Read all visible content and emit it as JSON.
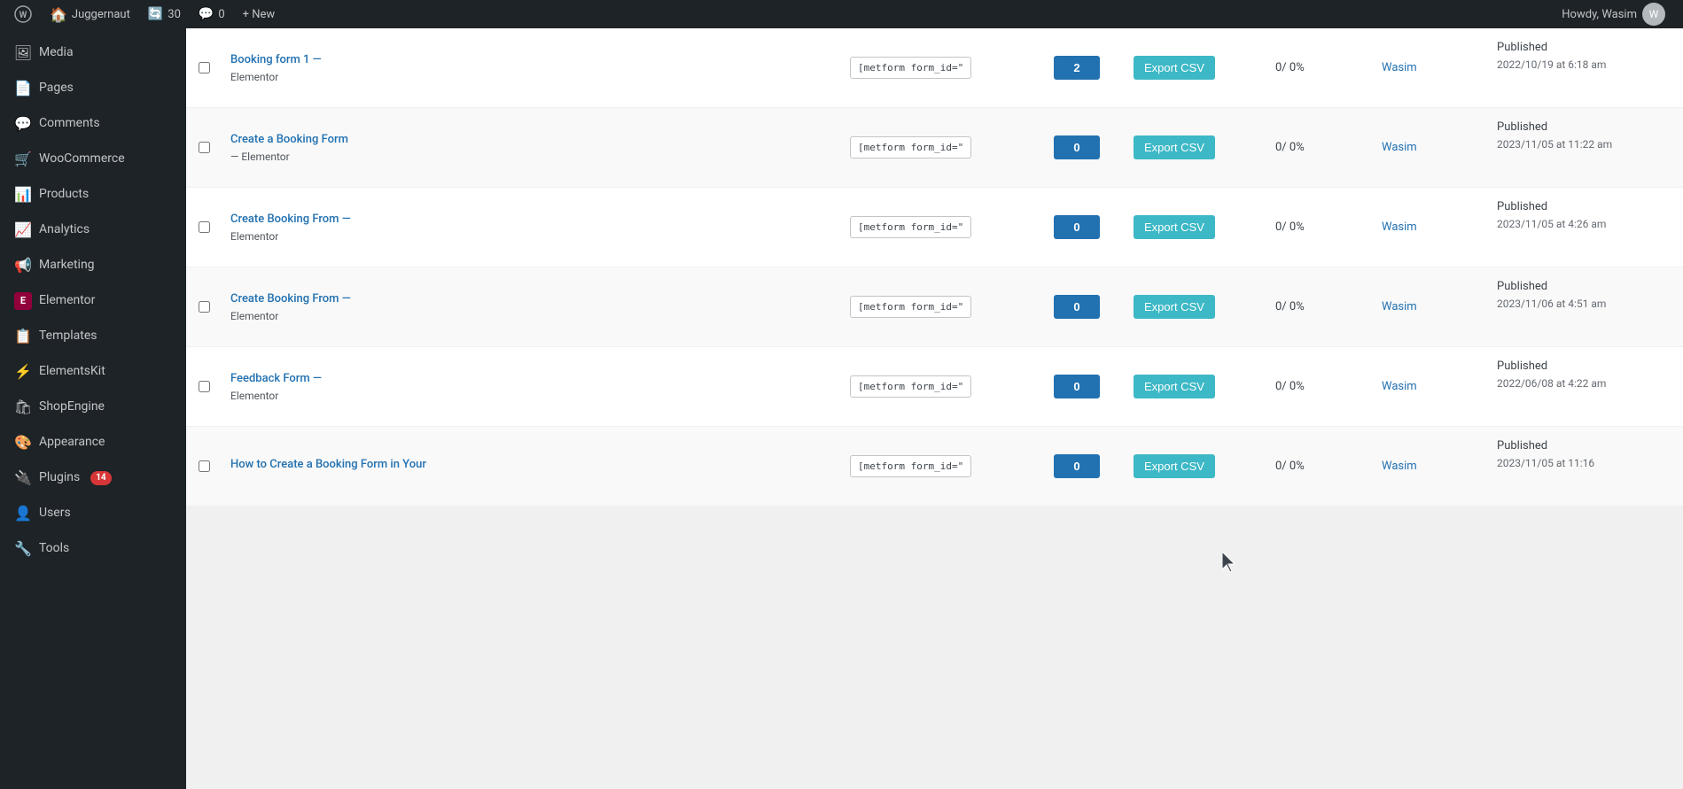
{
  "adminBar": {
    "siteName": "Juggernaut",
    "updates": "30",
    "comments": "0",
    "newLabel": "+ New",
    "howdy": "Howdy, Wasim"
  },
  "sidebar": {
    "items": [
      {
        "id": "media",
        "label": "Media",
        "icon": "🖼"
      },
      {
        "id": "pages",
        "label": "Pages",
        "icon": "📄"
      },
      {
        "id": "comments",
        "label": "Comments",
        "icon": "💬"
      },
      {
        "id": "woocommerce",
        "label": "WooCommerce",
        "icon": "🛒"
      },
      {
        "id": "products",
        "label": "Products",
        "icon": "📊"
      },
      {
        "id": "analytics",
        "label": "Analytics",
        "icon": "📈"
      },
      {
        "id": "marketing",
        "label": "Marketing",
        "icon": "📢"
      },
      {
        "id": "elementor",
        "label": "Elementor",
        "icon": "⬛"
      },
      {
        "id": "templates",
        "label": "Templates",
        "icon": "📋"
      },
      {
        "id": "elementskit",
        "label": "ElementsKit",
        "icon": "⚡"
      },
      {
        "id": "shopengine",
        "label": "ShopEngine",
        "icon": "🛍"
      },
      {
        "id": "appearance",
        "label": "Appearance",
        "icon": "🎨"
      },
      {
        "id": "plugins",
        "label": "Plugins",
        "icon": "🔌",
        "badge": "14"
      },
      {
        "id": "users",
        "label": "Users",
        "icon": "👤"
      },
      {
        "id": "tools",
        "label": "Tools",
        "icon": "🔧"
      }
    ]
  },
  "table": {
    "rows": [
      {
        "id": "row1",
        "title": "Booking form 1 —",
        "subtitle": "Elementor",
        "shortcode": "[metform form_id=\"",
        "count": "2",
        "stats": "0/ 0%",
        "author": "Wasim",
        "status": "Published",
        "date": "2022/10/19 at 6:18 am"
      },
      {
        "id": "row2",
        "title": "Create a Booking Form",
        "subtitle": "— Elementor",
        "shortcode": "[metform form_id=\"",
        "count": "0",
        "stats": "0/ 0%",
        "author": "Wasim",
        "status": "Published",
        "date": "2023/11/05 at 11:22 am"
      },
      {
        "id": "row3",
        "title": "Create Booking From —",
        "subtitle": "Elementor",
        "shortcode": "[metform form_id=\"",
        "count": "0",
        "stats": "0/ 0%",
        "author": "Wasim",
        "status": "Published",
        "date": "2023/11/05 at 4:26 am"
      },
      {
        "id": "row4",
        "title": "Create Booking From —",
        "subtitle": "Elementor",
        "shortcode": "[metform form_id=\"",
        "count": "0",
        "stats": "0/ 0%",
        "author": "Wasim",
        "status": "Published",
        "date": "2023/11/06 at 4:51 am"
      },
      {
        "id": "row5",
        "title": "Feedback Form —",
        "subtitle": "Elementor",
        "shortcode": "[metform form_id=\"",
        "count": "0",
        "stats": "0/ 0%",
        "author": "Wasim",
        "status": "Published",
        "date": "2022/06/08 at 4:22 am"
      },
      {
        "id": "row6",
        "title": "How to Create a Booking Form in Your",
        "subtitle": "",
        "shortcode": "[metform form_id=\"",
        "count": "0",
        "stats": "0/ 0%",
        "author": "Wasim",
        "status": "Published",
        "date": "2023/11/05 at 11:16"
      }
    ],
    "exportLabel": "Export CSV",
    "colors": {
      "countBg": "#2271b1",
      "exportBg": "#3db8c6"
    }
  }
}
